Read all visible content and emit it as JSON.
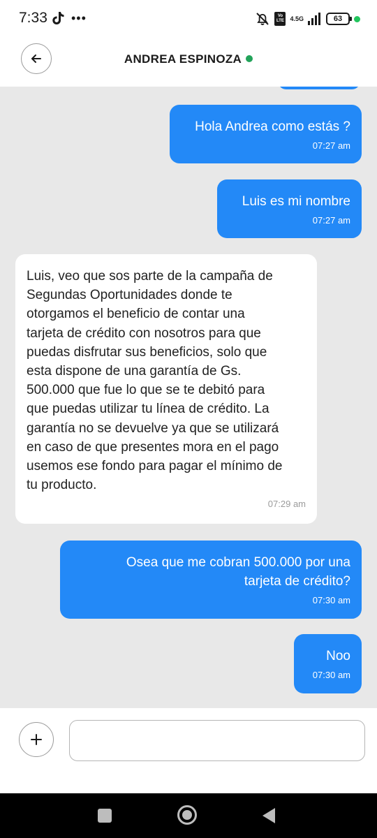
{
  "status_bar": {
    "time": "7:33",
    "more": "•••",
    "network": "4.5G",
    "volte": "Vo LTE",
    "battery": "63",
    "icons": [
      "tiktok-icon",
      "mute-icon",
      "volte-icon",
      "signal-icon",
      "battery-icon"
    ]
  },
  "header": {
    "contact_name": "ANDREA ESPINOZA",
    "online_color": "#22a35a",
    "back_icon": "arrow-left-icon"
  },
  "messages": [
    {
      "direction": "out",
      "text": "Hola Andrea como estás ?",
      "time": "07:27 am"
    },
    {
      "direction": "out",
      "text": "Luis es mi nombre",
      "time": "07:27 am"
    },
    {
      "direction": "in",
      "text": "Luis, veo que sos parte de la campaña de\nSegundas Oportunidades donde te\notorgamos el beneficio de contar una\ntarjeta de crédito con nosotros para que\npuedas disfrutar sus beneficios, solo que\nesta dispone de una garantía de Gs.\n500.000 que fue lo que se te debitó para\nque puedas utilizar tu línea de crédito. La\ngarantía no se devuelve ya que se utilizará\nen caso de que presentes mora en el pago\nusemos ese fondo para pagar el mínimo de\ntu producto.",
      "time": "07:29 am"
    },
    {
      "direction": "out",
      "text": "Osea que me cobran 500.000 por una\ntarjeta de crédito?",
      "time": "07:30 am"
    },
    {
      "direction": "out",
      "text": "Noo",
      "time": "07:30 am"
    }
  ],
  "composer": {
    "add_icon": "plus-icon",
    "input_value": "",
    "input_placeholder": ""
  },
  "nav_bar": {
    "icons": [
      "recents-square-icon",
      "home-circle-icon",
      "back-triangle-icon"
    ]
  },
  "colors": {
    "outgoing_bubble": "#2389f7",
    "incoming_bubble": "#ffffff",
    "chat_background": "#e8e8e8"
  }
}
